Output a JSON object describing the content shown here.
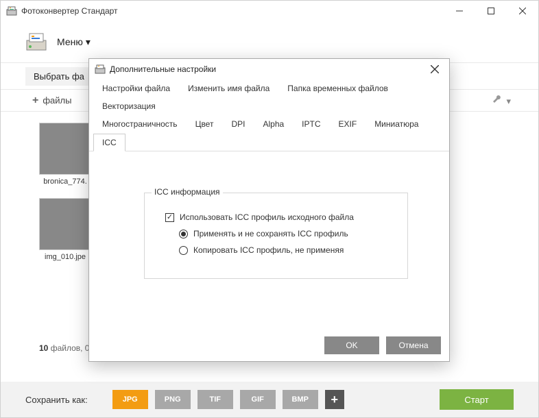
{
  "window": {
    "title": "Фотоконвертер Стандарт"
  },
  "menubar": {
    "menu_label": "Меню"
  },
  "toolbar": {
    "select_files": "Выбрать фа",
    "add_files": "файлы"
  },
  "thumbnails": [
    {
      "caption": "bronica_774."
    },
    {
      "caption": "img_010.jpe"
    }
  ],
  "status": {
    "count": "10",
    "suffix": "файлов, 0"
  },
  "bottombar": {
    "save_as": "Сохранить как:",
    "formats": [
      "JPG",
      "PNG",
      "TIF",
      "GIF",
      "BMP"
    ],
    "start": "Старт"
  },
  "dialog": {
    "title": "Дополнительные настройки",
    "tabs_row1": [
      "Настройки файла",
      "Изменить имя файла",
      "Папка временных файлов",
      "Векторизация"
    ],
    "tabs_row2": [
      "Многостраничность",
      "Цвет",
      "DPI",
      "Alpha",
      "IPTC",
      "EXIF",
      "Миниатюра",
      "ICC"
    ],
    "group_title": "ICC информация",
    "checkbox": "Использовать ICC профиль исходного файла",
    "radio1": "Применять и не сохранять ICC профиль",
    "radio2": "Копировать ICC профиль, не применяя",
    "ok": "OK",
    "cancel": "Отмена"
  }
}
